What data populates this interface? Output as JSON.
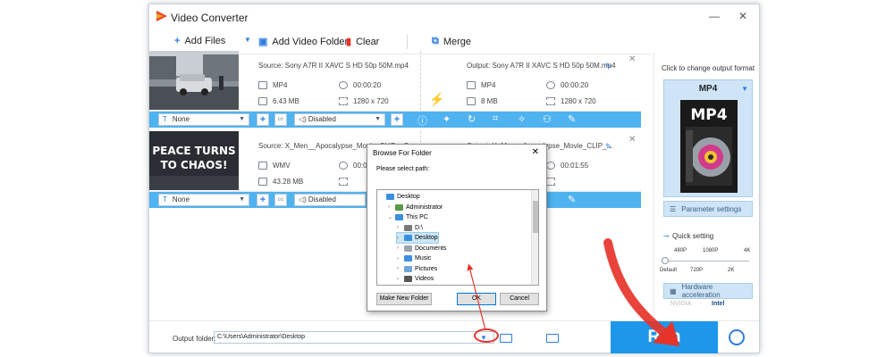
{
  "window": {
    "title": "Video Converter"
  },
  "toolbar": {
    "add_files": "Add Files",
    "add_video_folder": "Add Video Folder",
    "clear": "Clear",
    "merge": "Merge"
  },
  "files": [
    {
      "source_name": "Source: Sony A7R II XAVC S HD 50p 50M.mp4",
      "output_name": "Output: Sony A7R II XAVC S HD 50p 50M.mp4",
      "src_format": "MP4",
      "src_duration": "00:00:20",
      "src_size": "6.43 MB",
      "src_res": "1280 x 720",
      "out_format": "MP4",
      "out_duration": "00:00:20",
      "out_size": "8 MB",
      "out_res": "1280 x 720",
      "subtitle": "None",
      "audio": "Disabled"
    },
    {
      "source_name": "Source: X_Men__Apocalypse_Movie_CLIP__Cyc...",
      "output_name": "Output: X_Men__Apocalypse_Movie_CLIP_...",
      "src_format": "WMV",
      "src_duration": "00:00:20",
      "src_size": "43.28 MB",
      "src_res": "",
      "out_format": "",
      "out_duration": "00:01:55",
      "out_size": "",
      "out_res": "",
      "thumb_text_1": "PEACE TURNS",
      "thumb_text_2": "TO CHAOS!",
      "subtitle": "None",
      "audio": "Disabled"
    }
  ],
  "right_panel": {
    "hint": "Click to change output format",
    "format": "MP4",
    "format_art_label": "MP4",
    "parameter_settings": "Parameter settings",
    "quick_setting": "Quick setting",
    "ticks_top": [
      "480P",
      "1080P",
      "4K"
    ],
    "ticks_bottom": [
      "Default",
      "720P",
      "2K"
    ],
    "hardware_acceleration": "Hardware acceleration",
    "nvidia": "NVIDIA",
    "intel": "Intel"
  },
  "bottom": {
    "output_folder_label": "Output folder:",
    "output_path": "C:\\Users\\Administrator\\Desktop",
    "run": "Run"
  },
  "dialog": {
    "title": "Browse For Folder",
    "prompt": "Please select path:",
    "tree": [
      {
        "label": "Desktop",
        "indent": 0,
        "arrow": "",
        "icon_color": "#3c8fe0"
      },
      {
        "label": "Administrator",
        "indent": 1,
        "arrow": ">",
        "icon_color": "#5a9a48"
      },
      {
        "label": "This PC",
        "indent": 1,
        "arrow": "v",
        "icon_color": "#3c8fe0"
      },
      {
        "label": "D:\\",
        "indent": 2,
        "arrow": ">",
        "icon_color": "#7a7a7a"
      },
      {
        "label": "Desktop",
        "indent": 2,
        "arrow": ">",
        "icon_color": "#3c8fe0",
        "selected": true
      },
      {
        "label": "Documents",
        "indent": 2,
        "arrow": ">",
        "icon_color": "#9aa4ae"
      },
      {
        "label": "Music",
        "indent": 2,
        "arrow": ">",
        "icon_color": "#3c8fe0"
      },
      {
        "label": "Pictures",
        "indent": 2,
        "arrow": ">",
        "icon_color": "#6fa8d8"
      },
      {
        "label": "Videos",
        "indent": 2,
        "arrow": ">",
        "icon_color": "#555555"
      }
    ],
    "make_new_folder": "Make New Folder",
    "ok": "OK",
    "cancel": "Cancel"
  },
  "colors": {
    "accent": "#1e97ea",
    "edit_bar": "#4fb3f0",
    "annotation_red": "#e6342a"
  }
}
